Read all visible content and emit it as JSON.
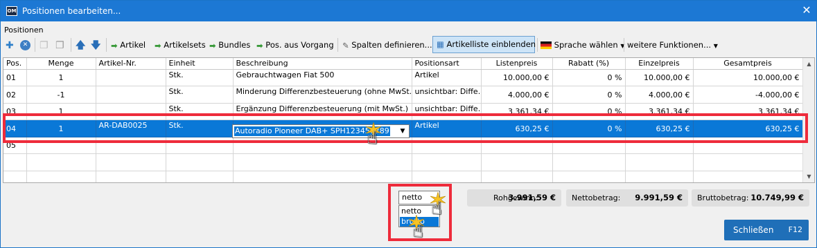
{
  "window": {
    "title": "Positionen bearbeiten...",
    "app_icon_text": "OM",
    "close_glyph": "✕"
  },
  "group_label": "Positionen",
  "toolbar": {
    "add_icon": "✚",
    "remove_icon": "✕",
    "copy_icon": "❐",
    "paste_icon": "❐",
    "up_icon": "🡅",
    "down_icon": "🡇",
    "artikel": "Artikel",
    "artikelsets": "Artikelsets",
    "bundles": "Bundles",
    "pos_aus_vorgang": "Pos. aus Vorgang",
    "spalten": "Spalten definieren...",
    "artikelliste": "Artikelliste einblenden",
    "sprache": "Sprache wählen",
    "weitere": "weitere Funktionen..."
  },
  "columns": [
    "Pos.",
    "Menge",
    "Artikel-Nr.",
    "Einheit",
    "Beschreibung",
    "Positionsart",
    "Listenpreis",
    "Rabatt (%)",
    "Einzelpreis",
    "Gesamtpreis"
  ],
  "rows": [
    {
      "pos": "01",
      "menge": "1",
      "artnr": "",
      "einheit": "Stk.",
      "beschreibung": "Gebrauchtwagen Fiat 500",
      "art": "Artikel",
      "liste": "10.000,00 €",
      "rabatt": "0 %",
      "einzel": "10.000,00 €",
      "gesamt": "10.000,00 €"
    },
    {
      "pos": "02",
      "menge": "-1",
      "artnr": "",
      "einheit": "Stk.",
      "beschreibung": "Minderung Differenzbesteuerung (ohne MwSt.)",
      "art": "unsichtbar: Diffe...",
      "liste": "4.000,00 €",
      "rabatt": "0 %",
      "einzel": "4.000,00 €",
      "gesamt": "-4.000,00 €"
    },
    {
      "pos": "03",
      "menge": "1",
      "artnr": "",
      "einheit": "Stk.",
      "beschreibung": "Ergänzung Differenzbesteuerung (mit MwSt.)",
      "art": "unsichtbar: Diffe...",
      "liste": "3.361,34 €",
      "rabatt": "0 %",
      "einzel": "3.361,34 €",
      "gesamt": "3.361,34 €"
    },
    {
      "pos": "04",
      "menge": "1",
      "artnr": "AR-DAB0025",
      "einheit": "Stk.",
      "beschreibung": "Autoradio Pioneer DAB+ SPH123456789",
      "art": "Artikel",
      "liste": "630,25 €",
      "rabatt": "0 %",
      "einzel": "630,25 €",
      "gesamt": "630,25 €"
    },
    {
      "pos": "05",
      "menge": "",
      "artnr": "",
      "einheit": "",
      "beschreibung": "",
      "art": "",
      "liste": "",
      "rabatt": "",
      "einzel": "",
      "gesamt": ""
    }
  ],
  "selected_row": "04",
  "mode": {
    "selected": "netto",
    "options": [
      "netto",
      "brutto"
    ],
    "highlighted": "brutto"
  },
  "totals": {
    "rohgewinn_label": "Rohgewinn:",
    "rohgewinn": "3.991,59 €",
    "netto_label": "Nettobetrag:",
    "netto": "9.991,59 €",
    "brutto_label": "Bruttobetrag:",
    "brutto": "10.749,99 €"
  },
  "close_button": {
    "label": "Schließen",
    "key": "F12"
  },
  "colors": {
    "titlebar": "#1c78d4",
    "selection": "#0a78d7",
    "highlight": "#ee2b3b",
    "button": "#1f6fb8"
  }
}
